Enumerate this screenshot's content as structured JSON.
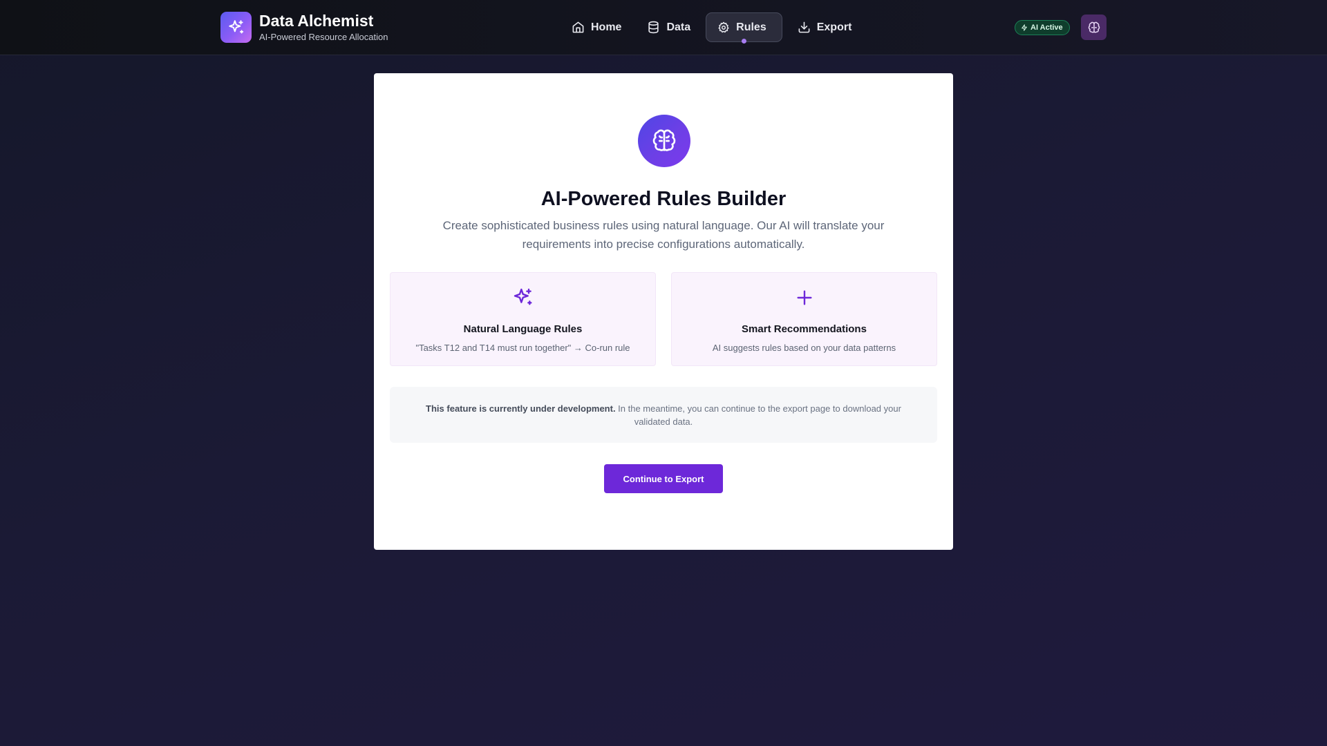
{
  "header": {
    "brand_title": "Data Alchemist",
    "brand_subtitle": "AI-Powered Resource Allocation",
    "nav": [
      {
        "label": "Home",
        "icon": "home-icon"
      },
      {
        "label": "Data",
        "icon": "database-icon"
      },
      {
        "label": "Rules",
        "icon": "gear-icon",
        "active": true
      },
      {
        "label": "Export",
        "icon": "download-icon"
      }
    ],
    "status_badge": "AI Active",
    "status_color": "#1b8157"
  },
  "main": {
    "title": "AI-Powered Rules Builder",
    "description": "Create sophisticated business rules using natural language. Our AI will translate your requirements into precise configurations automatically.",
    "features": [
      {
        "title": "Natural Language Rules",
        "description": "\"Tasks T12 and T14 must run together\" → Co-run rule",
        "icon": "sparkles-icon"
      },
      {
        "title": "Smart Recommendations",
        "description": "AI suggests rules based on your data patterns",
        "icon": "plus-icon"
      }
    ],
    "notice_bold": "This feature is currently under development.",
    "notice_text": " In the meantime, you can continue to the export page to download your validated data.",
    "cta_label": "Continue to Export"
  },
  "colors": {
    "accent": "#6d28d9",
    "card_bg": "#ffffff",
    "page_bg": "#1b1a35"
  }
}
